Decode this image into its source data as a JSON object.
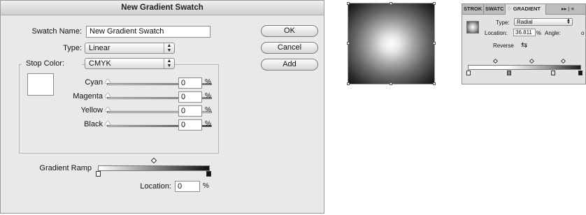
{
  "dialog": {
    "title": "New Gradient Swatch",
    "swatch_name_label": "Swatch Name:",
    "swatch_name_value": "New Gradient Swatch",
    "type_label": "Type:",
    "type_value": "Linear",
    "stop_color_label": "Stop Color:",
    "stop_color_value": "CMYK",
    "buttons": {
      "ok": "OK",
      "cancel": "Cancel",
      "add": "Add"
    },
    "sliders": [
      {
        "label": "Cyan",
        "value": "0",
        "unit": "%"
      },
      {
        "label": "Magenta",
        "value": "0",
        "unit": "%"
      },
      {
        "label": "Yellow",
        "value": "0",
        "unit": "%"
      },
      {
        "label": "Black",
        "value": "0",
        "unit": "%"
      }
    ],
    "gradient_ramp_label": "Gradient Ramp",
    "location_label": "Location:",
    "location_value": "0",
    "location_unit": "%"
  },
  "panel": {
    "tabs": [
      "STROK",
      "SWATC",
      "♢ GRADIENT"
    ],
    "menu_glyph": "▸▸ | ≡",
    "type_label": "Type:",
    "type_value": "Radial",
    "location_label": "Location:",
    "location_value": "36.811",
    "location_unit": "%",
    "angle_label": "Angle:",
    "angle_value": "o",
    "reverse_label": "Reverse",
    "reverse_icon": "⇆"
  },
  "colors": {
    "dialog_bg": "#e9e9e9",
    "panel_bg": "#e2e2e2",
    "ramp_start": "#ffffff",
    "ramp_end": "#111111"
  },
  "icons": [
    "popup-arrows-icon",
    "slider-thumb-icon",
    "gradient-stop-icon",
    "midpoint-diamond-icon",
    "reverse-icon",
    "panel-menu-icon"
  ]
}
